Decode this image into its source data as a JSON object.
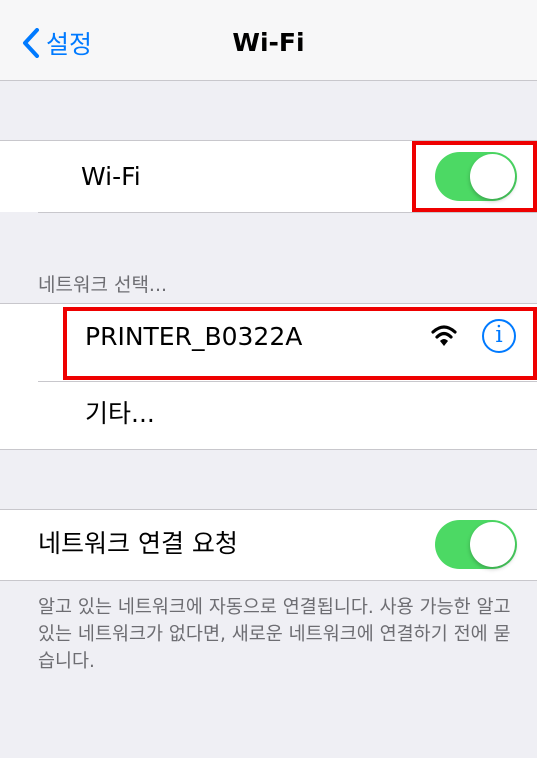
{
  "navbar": {
    "back_label": "설정",
    "title": "Wi-Fi"
  },
  "wifi_toggle": {
    "label": "Wi-Fi",
    "state": "on"
  },
  "network_section": {
    "header": "네트워크 선택...",
    "networks": [
      {
        "name": "PRINTER_B0322A",
        "icons": [
          "wifi-signal-icon",
          "info-icon"
        ]
      }
    ],
    "other_label": "기타..."
  },
  "ask_to_join": {
    "label": "네트워크 연결 요청",
    "state": "on",
    "footer": "알고 있는 네트워크에 자동으로 연결됩니다. 사용 가능한 알고 있는 네트워크가 없다면, 새로운 네트워크에 연결하기 전에 묻습니다."
  },
  "info_glyph": "i",
  "colors": {
    "accent": "#007aff",
    "toggle_on": "#4cd964",
    "highlight_box": "#ee0000",
    "group_background": "#efeff4"
  }
}
